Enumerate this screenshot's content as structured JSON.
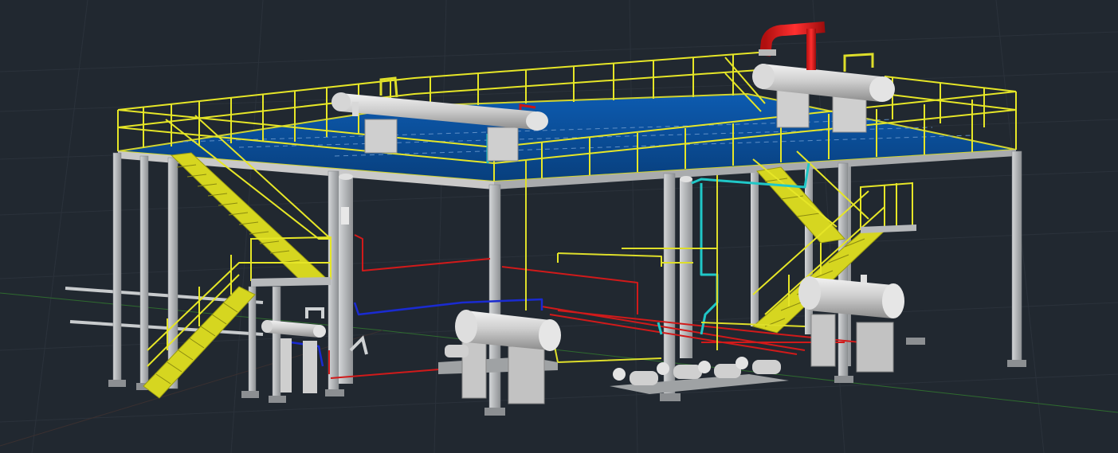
{
  "viewport": {
    "background": "#212830",
    "grid_color": "#2b323b",
    "axis_x_color": "#2f6b2f",
    "axis_y_color": "#5a2a2a"
  },
  "colors": {
    "structure": "#b9bcbe",
    "structure_dark": "#8f9396",
    "handrail": "#e6e627",
    "stair": "#d9d920",
    "deck": "#0b4f9c",
    "deck_edge": "#c6c93a",
    "vessel": "#c9c9c9",
    "vessel_light": "#e8e8e8",
    "pipe_red": "#d11a1a",
    "pipe_blue": "#1a2bd1",
    "pipe_cyan": "#20c7c7",
    "pipe_yellow": "#dede2a",
    "hot_elbow": "#cc1616",
    "pipe_white": "#cfd2d4"
  },
  "model": {
    "platform": "elevated-platform",
    "exchangers": [
      "top-left-exchanger",
      "top-right-exchanger",
      "ground-drum-center",
      "ground-drum-right",
      "small-exchanger-left"
    ],
    "pumps": [
      "pump-1",
      "pump-2",
      "pump-3",
      "pump-4"
    ],
    "stairs": [
      "stair-left",
      "stair-right"
    ]
  }
}
